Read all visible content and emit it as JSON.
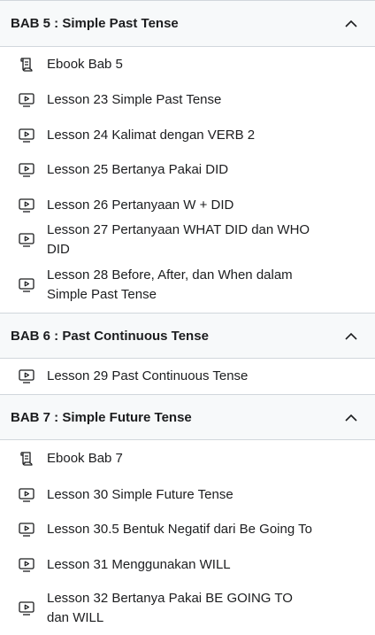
{
  "sections": [
    {
      "title": "BAB 5 : Simple Past Tense",
      "items": [
        {
          "type": "ebook",
          "icon": "document-icon",
          "label": "Ebook Bab 5"
        },
        {
          "type": "video",
          "icon": "video-icon",
          "label": "Lesson 23 Simple Past Tense"
        },
        {
          "type": "video",
          "icon": "video-icon",
          "label": "Lesson 24 Kalimat dengan VERB 2"
        },
        {
          "type": "video",
          "icon": "video-icon",
          "label": "Lesson 25 Bertanya Pakai DID"
        },
        {
          "type": "video",
          "icon": "video-icon",
          "label": "Lesson 26 Pertanyaan W + DID"
        },
        {
          "type": "video",
          "icon": "video-icon",
          "label": "Lesson 27 Pertanyaan WHAT DID dan WHO DID"
        },
        {
          "type": "video",
          "icon": "video-icon",
          "label": "Lesson 28 Before, After, dan When dalam Simple Past Tense"
        }
      ]
    },
    {
      "title": "BAB 6 : Past Continuous Tense",
      "items": [
        {
          "type": "video",
          "icon": "video-icon",
          "label": "Lesson 29 Past Continuous Tense"
        }
      ]
    },
    {
      "title": "BAB 7 : Simple Future Tense",
      "items": [
        {
          "type": "ebook",
          "icon": "document-icon",
          "label": "Ebook Bab 7"
        },
        {
          "type": "video",
          "icon": "video-icon",
          "label": "Lesson 30 Simple Future Tense"
        },
        {
          "type": "video",
          "icon": "video-icon",
          "label": "Lesson 30.5 Bentuk Negatif dari Be Going To"
        },
        {
          "type": "video",
          "icon": "video-icon",
          "label": "Lesson 31 Menggunakan WILL"
        },
        {
          "type": "video",
          "icon": "video-icon",
          "label": "Lesson 32 Bertanya Pakai BE GOING TO dan WILL"
        }
      ]
    }
  ]
}
